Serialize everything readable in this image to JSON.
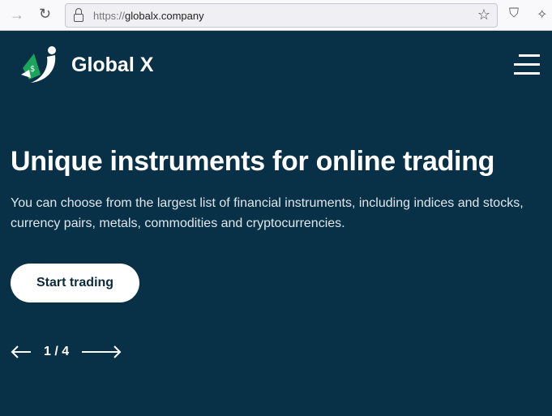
{
  "browser": {
    "url_scheme": "https://",
    "url_host": "globalx.company",
    "icons": [
      "forward-icon",
      "reload-icon",
      "lock-icon",
      "star-icon",
      "shield-icon",
      "extension-icon"
    ]
  },
  "header": {
    "brand": "Global X"
  },
  "hero": {
    "title": "Unique instruments for online trading",
    "subtitle": "You can choose from the largest list of financial instruments, including indices and stocks, currency pairs, metals, commodities and cryptocurrencies.",
    "cta": "Start trading"
  },
  "pager": {
    "current": "1",
    "total": "4",
    "sep": " / "
  },
  "colors": {
    "background": "#083148",
    "accent": "#1aa55a",
    "button": "#ffffff"
  }
}
